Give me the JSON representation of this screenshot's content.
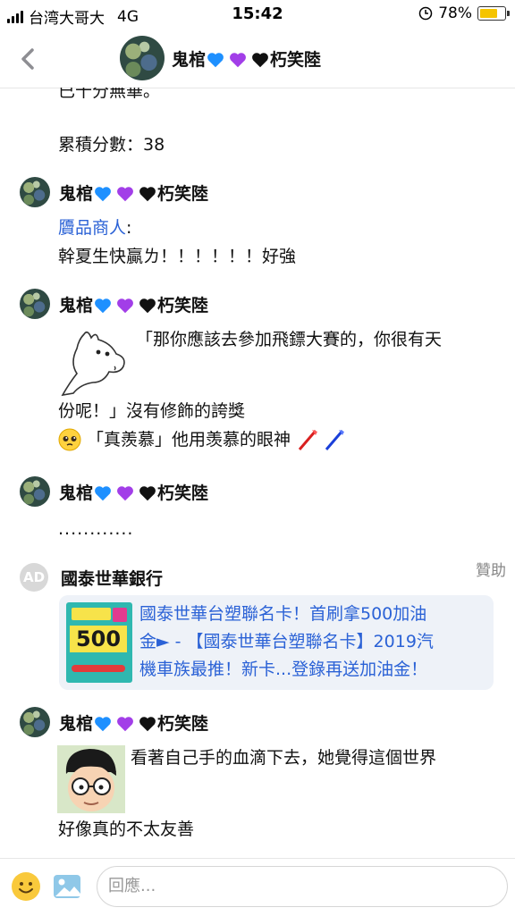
{
  "status": {
    "carrier": "台湾大哥大",
    "network": "4G",
    "time": "15:42",
    "battery": "78%",
    "battery_level": 0.78
  },
  "header": {
    "name": "鬼棺",
    "suffix_name": "朽笑陸",
    "heart_colors": [
      "#1e90ff",
      "#a23ee8",
      "#111111"
    ]
  },
  "partial_top": {
    "cut_line": "已十分無華。",
    "score": "累積分數：38"
  },
  "messages": [
    {
      "author": "鬼棺",
      "author_suffix": "朽笑陸",
      "mention": "贗品商人",
      "mention_sep": ":",
      "body": "幹夏生快贏ㄌ！！！！！！好強"
    },
    {
      "author": "鬼棺",
      "author_suffix": "朽笑陸",
      "sticker": "moomin-sticker",
      "line1": "「那你應該去參加飛鏢大賽的，你很有天",
      "line2": "份呢！」沒有修飾的誇獎",
      "line3": "「真羨慕」他用羡慕的眼神"
    },
    {
      "author": "鬼棺",
      "author_suffix": "朽笑陸",
      "body": "............"
    },
    {
      "author": "鬼棺",
      "author_suffix": "朽笑陸",
      "sticker": "glasses-face-sticker",
      "line1": "看著自己手的血滴下去，她覺得這個世界",
      "line2": "好像真的不太友善"
    }
  ],
  "ad": {
    "badge": "AD",
    "advertiser": "國泰世華銀行",
    "sponsored": "贊助",
    "thumb_number": "500",
    "line1": "國泰世華台塑聯名卡！首刷拿500加油",
    "line2": "金► - 【國泰世華台塑聯名卡】2019汽",
    "line3": "機車族最推！新卡...登錄再送加油金！"
  },
  "composer": {
    "placeholder": "回應..."
  },
  "icons": {
    "back": "chevron-left-icon",
    "emoji": "emoji-icon",
    "image": "image-icon",
    "alarm": "alarm-lock-icon"
  }
}
